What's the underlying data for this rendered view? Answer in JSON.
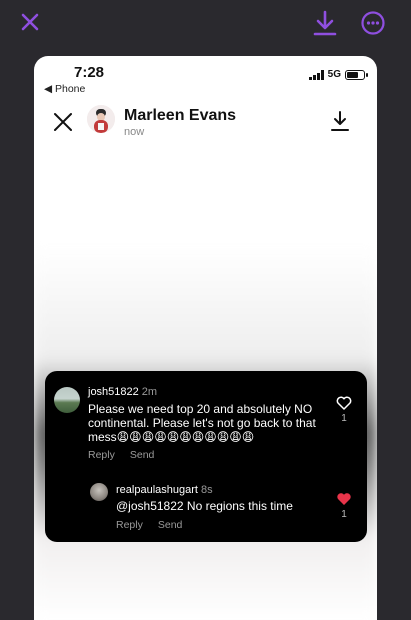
{
  "top_bar": {
    "close_icon": "close-x-icon",
    "download_icon": "download-icon",
    "more_icon": "more-options-icon",
    "accent_color": "#8f4fe0"
  },
  "phone": {
    "status_time": "7:28",
    "back_label": "◀ Phone",
    "network": "5G",
    "story_user": "Marleen Evans",
    "story_time": "now"
  },
  "comments": [
    {
      "username": "josh51822",
      "age": "2m",
      "text": "Please we need top 20 and absolutely NO continental. Please let's not go back to that mess😩😩😩😩😩😩😩😩😩😩😩",
      "reply_label": "Reply",
      "send_label": "Send",
      "likes": "1",
      "liked": false
    },
    {
      "username": "realpaulashugart",
      "age": "8s",
      "text": "@josh51822 No regions this time",
      "reply_label": "Reply",
      "send_label": "Send",
      "likes": "1",
      "liked": true,
      "heart_color": "#e8344a"
    }
  ]
}
